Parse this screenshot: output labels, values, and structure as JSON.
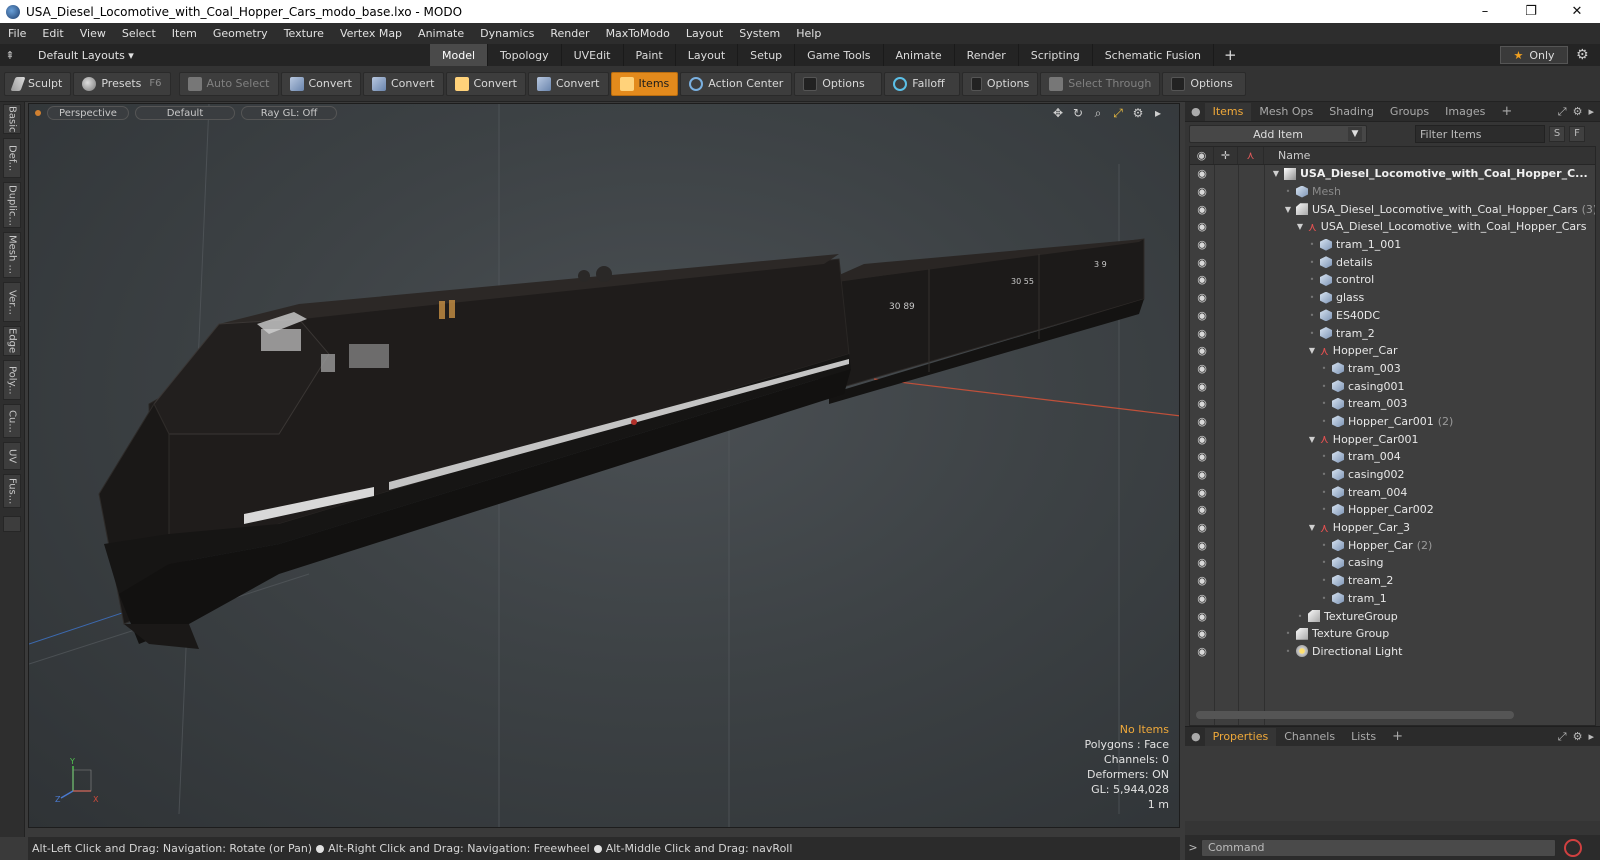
{
  "window": {
    "title": "USA_Diesel_Locomotive_with_Coal_Hopper_Cars_modo_base.lxo - MODO",
    "minimize": "–",
    "restore": "❐",
    "close": "✕"
  },
  "menu": [
    "File",
    "Edit",
    "View",
    "Select",
    "Item",
    "Geometry",
    "Texture",
    "Vertex Map",
    "Animate",
    "Dynamics",
    "Render",
    "MaxToModo",
    "Layout",
    "System",
    "Help"
  ],
  "layout_bar": {
    "layouts_label": "Default Layouts ▾",
    "tabs": [
      "Model",
      "Topology",
      "UVEdit",
      "Paint",
      "Layout",
      "Setup",
      "Game Tools",
      "Animate",
      "Render",
      "Scripting",
      "Schematic Fusion"
    ],
    "active_tab": "Model",
    "plus": "+",
    "only_label": "Only"
  },
  "toolbar": {
    "sculpt": "Sculpt",
    "presets": "Presets",
    "presets_key": "F6",
    "auto_select": "Auto Select",
    "convert_1": "Convert",
    "convert_2": "Convert",
    "convert_3": "Convert",
    "convert_4": "Convert",
    "items": "Items",
    "action_center": "Action Center",
    "options_1": "Options",
    "falloff": "Falloff",
    "options_2": "Options",
    "select_through": "Select Through",
    "options_3": "Options"
  },
  "left_tabs": [
    "Basic",
    "Def...",
    "Duplic...",
    "Mesh ...",
    "Ver...",
    "Edge",
    "Poly...",
    "Cu...",
    "UV",
    "Fus..."
  ],
  "viewport": {
    "view": "Perspective",
    "shading": "Default",
    "raygl": "Ray GL: Off",
    "stats": {
      "no_items": "No Items",
      "polygons": "Polygons : Face",
      "channels": "Channels: 0",
      "deformers": "Deformers: ON",
      "gl": "GL: 5,944,028",
      "scale": "1 m"
    },
    "axis_labels": {
      "y": "Y",
      "z": "Z",
      "x": "X"
    },
    "car_numbers": [
      "30 89",
      "30 55",
      "3 9"
    ]
  },
  "status_bar": {
    "hint1": "Alt-Left Click and Drag: Navigation: Rotate (or Pan)",
    "hint2": "Alt-Right Click and Drag: Navigation: Freewheel",
    "hint3": "Alt-Middle Click and Drag: navRoll"
  },
  "items_panel": {
    "tabs": [
      "Items",
      "Mesh Ops",
      "Shading",
      "Groups",
      "Images"
    ],
    "active_tab": "Items",
    "add_item": "Add Item",
    "filter_placeholder": "Filter Items",
    "s_button": "S",
    "f_button": "F",
    "name_header": "Name",
    "tree": [
      {
        "indent": 0,
        "toggle": "▼",
        "icon": "scene",
        "name": "USA_Diesel_Locomotive_with_Coal_Hopper_C...",
        "count": "",
        "style": "root"
      },
      {
        "indent": 1,
        "toggle": "",
        "icon": "mesh",
        "name": "Mesh",
        "count": "",
        "style": "dim"
      },
      {
        "indent": 1,
        "toggle": "▼",
        "icon": "group",
        "name": "USA_Diesel_Locomotive_with_Coal_Hopper_Cars",
        "count": "(3)",
        "style": ""
      },
      {
        "indent": 2,
        "toggle": "▼",
        "icon": "locator",
        "name": "USA_Diesel_Locomotive_with_Coal_Hopper_Cars",
        "count": "",
        "style": ""
      },
      {
        "indent": 3,
        "toggle": "",
        "icon": "mesh",
        "name": "tram_1_001",
        "count": "",
        "style": ""
      },
      {
        "indent": 3,
        "toggle": "",
        "icon": "mesh",
        "name": "details",
        "count": "",
        "style": ""
      },
      {
        "indent": 3,
        "toggle": "",
        "icon": "mesh",
        "name": "control",
        "count": "",
        "style": ""
      },
      {
        "indent": 3,
        "toggle": "",
        "icon": "mesh",
        "name": "glass",
        "count": "",
        "style": ""
      },
      {
        "indent": 3,
        "toggle": "",
        "icon": "mesh",
        "name": "ES40DC",
        "count": "",
        "style": ""
      },
      {
        "indent": 3,
        "toggle": "",
        "icon": "mesh",
        "name": "tram_2",
        "count": "",
        "style": ""
      },
      {
        "indent": 3,
        "toggle": "▼",
        "icon": "locator",
        "name": "Hopper_Car",
        "count": "",
        "style": ""
      },
      {
        "indent": 4,
        "toggle": "",
        "icon": "mesh",
        "name": "tram_003",
        "count": "",
        "style": ""
      },
      {
        "indent": 4,
        "toggle": "",
        "icon": "mesh",
        "name": "casing001",
        "count": "",
        "style": ""
      },
      {
        "indent": 4,
        "toggle": "",
        "icon": "mesh",
        "name": "tream_003",
        "count": "",
        "style": ""
      },
      {
        "indent": 4,
        "toggle": "",
        "icon": "mesh",
        "name": "Hopper_Car001",
        "count": "(2)",
        "style": ""
      },
      {
        "indent": 3,
        "toggle": "▼",
        "icon": "locator",
        "name": "Hopper_Car001",
        "count": "",
        "style": ""
      },
      {
        "indent": 4,
        "toggle": "",
        "icon": "mesh",
        "name": "tram_004",
        "count": "",
        "style": ""
      },
      {
        "indent": 4,
        "toggle": "",
        "icon": "mesh",
        "name": "casing002",
        "count": "",
        "style": ""
      },
      {
        "indent": 4,
        "toggle": "",
        "icon": "mesh",
        "name": "tream_004",
        "count": "",
        "style": ""
      },
      {
        "indent": 4,
        "toggle": "",
        "icon": "mesh",
        "name": "Hopper_Car002",
        "count": "",
        "style": ""
      },
      {
        "indent": 3,
        "toggle": "▼",
        "icon": "locator",
        "name": "Hopper_Car_3",
        "count": "",
        "style": ""
      },
      {
        "indent": 4,
        "toggle": "",
        "icon": "mesh",
        "name": "Hopper_Car",
        "count": "(2)",
        "style": ""
      },
      {
        "indent": 4,
        "toggle": "",
        "icon": "mesh",
        "name": "casing",
        "count": "",
        "style": ""
      },
      {
        "indent": 4,
        "toggle": "",
        "icon": "mesh",
        "name": "tream_2",
        "count": "",
        "style": ""
      },
      {
        "indent": 4,
        "toggle": "",
        "icon": "mesh",
        "name": "tram_1",
        "count": "",
        "style": ""
      },
      {
        "indent": 2,
        "toggle": "",
        "icon": "group",
        "name": "TextureGroup",
        "count": "",
        "style": ""
      },
      {
        "indent": 1,
        "toggle": "",
        "icon": "group",
        "name": "Texture Group",
        "count": "",
        "style": ""
      },
      {
        "indent": 1,
        "toggle": "",
        "icon": "light",
        "name": "Directional Light",
        "count": "",
        "style": ""
      }
    ]
  },
  "properties_panel": {
    "tabs": [
      "Properties",
      "Channels",
      "Lists"
    ],
    "active_tab": "Properties",
    "command_placeholder": "Command"
  },
  "colors": {
    "accent": "#e38a1c",
    "active_tab_text": "#f0a93a",
    "viewport_bg": "#3d4245"
  }
}
